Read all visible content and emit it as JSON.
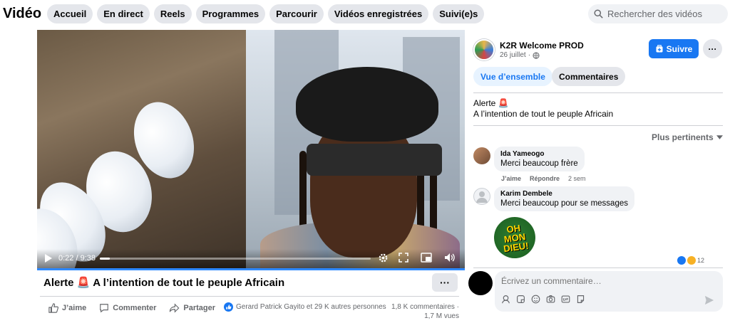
{
  "header": {
    "title": "Vidéo",
    "tabs": [
      "Accueil",
      "En direct",
      "Reels",
      "Programmes",
      "Parcourir",
      "Vidéos enregistrées",
      "Suivi(e)s"
    ],
    "search_placeholder": "Rechercher des vidéos"
  },
  "player": {
    "time_current": "0:22",
    "time_sep": " / ",
    "time_total": "9:38",
    "progress_fraction": 0.038
  },
  "post": {
    "title": "Alerte",
    "title_emoji": "🚨",
    "title_rest": "A l’intention de tout le peuple Africain",
    "more": "···",
    "actions": {
      "like": "J’aime",
      "comment": "Commenter",
      "share": "Partager"
    },
    "reactions_text": "Gerard Patrick Gayito et 29 K autres personnes",
    "comments_count": "1,8 K commentaires ·",
    "views": "1,7 M vues"
  },
  "panel": {
    "page_name": "K2R Welcome PROD",
    "date": "26 juillet",
    "follow_label": "Suivre",
    "tabs": {
      "overview": "Vue d’ensemble",
      "comments": "Commentaires"
    },
    "description_line1": "Alerte 🚨",
    "description_line2": "A l’intention de tout le peuple Africain",
    "sort_label": "Plus pertinents",
    "comments": [
      {
        "name": "Ida Yameogo",
        "text": "Merci beaucoup frère",
        "like": "J’aime",
        "reply": "Répondre",
        "time": "2 sem"
      },
      {
        "name": "Karim Dembele",
        "text": "Merci beaucoup pour se messages"
      }
    ],
    "sticker_lines": [
      "OH",
      "MON",
      "DIEU!"
    ],
    "sticker_reactions": "12",
    "composer_placeholder": "Écrivez un commentaire…"
  },
  "colors": {
    "accent": "#1877f2",
    "chip": "#e4e6eb",
    "muted": "#65676b"
  }
}
